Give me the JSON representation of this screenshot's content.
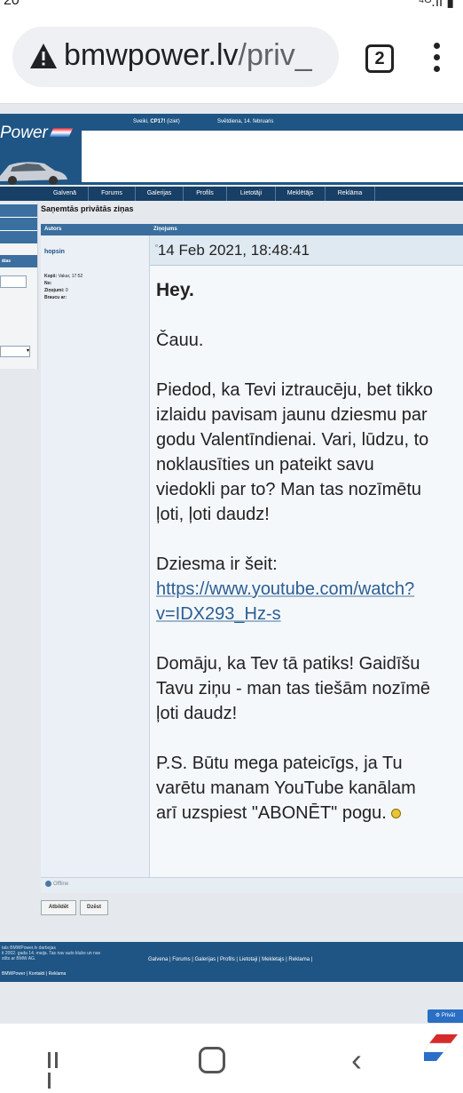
{
  "status_bar": {
    "time": "20",
    "icons_text": "⁴ᴳ.ıl ▮"
  },
  "browser": {
    "url_host": "bmwpower.lv",
    "url_path": "/priv_",
    "tab_count": "2"
  },
  "site": {
    "logo_text": "Power",
    "greeting_prefix": "Sveiki, ",
    "greeting_user": "CP17!",
    "greeting_suffix": " (iziet)",
    "date": "Svētdiena, 14. februaris",
    "nav": [
      "Galvenā",
      "Forums",
      "Galerijas",
      "Profils",
      "Lietotāji",
      "Meklētājs",
      "Reklāma"
    ],
    "sidebar_label": "ātas",
    "sidebar_select": "▾"
  },
  "pm": {
    "title": "Saņemtās privātās ziņas",
    "col_author": "Autors",
    "col_message": "Ziņojums",
    "author": "hopsin",
    "meta": [
      {
        "k": "Kopš: ",
        "v": "Vakar, 17:52"
      },
      {
        "k": "No: ",
        "v": ""
      },
      {
        "k": "Ziņojumi: ",
        "v": "0"
      },
      {
        "k": "Braucu ar: ",
        "v": ""
      }
    ],
    "date": "14 Feb 2021, 18:48:41",
    "message": {
      "hey": "Hey.",
      "p1": "Čauu.",
      "p2_lines": [
        "Piedod, ka Tevi iztraucēju, bet tikko",
        "izlaidu pavisam jaunu dziesmu par",
        "godu Valentīndienai. Vari, lūdzu, to",
        "noklausīties un pateikt savu",
        "viedokli par to? Man tas nozīmētu",
        "ļoti, ļoti daudz!"
      ],
      "p3_label": "Dziesma ir šeit:",
      "link_line1": "https://www.youtube.com/watch?",
      "link_line2": "v=IDX293_Hz-s",
      "p4_lines": [
        "Domāju, ka Tev tā patiks! Gaidīšu",
        "Tavu ziņu - man tas tiešām nozīmē",
        "ļoti daudz!"
      ],
      "p5_lines": [
        "P.S. Būtu mega pateicīgs, ja Tu",
        "varētu manam YouTube kanālam",
        "arī uzspiest \"ABONĒT\" pogu."
      ]
    },
    "status": "Offline",
    "reply_button": "Atbildēt",
    "delete_button": "Dzēst"
  },
  "footer": {
    "left_lines": [
      "tals BMWPower.lv darbojas",
      "it 2002. gada 14. maija. Tas nav auto klubs un nav",
      "stīts ar BMW AG."
    ],
    "links": "Galvena | Forums | Galerijas | Profils | Lietotaji | Mekletajs | Reklama |",
    "bottom_links": "BMWPower | Kontakti | Reklama",
    "private_button": "⚙ Privāt"
  }
}
